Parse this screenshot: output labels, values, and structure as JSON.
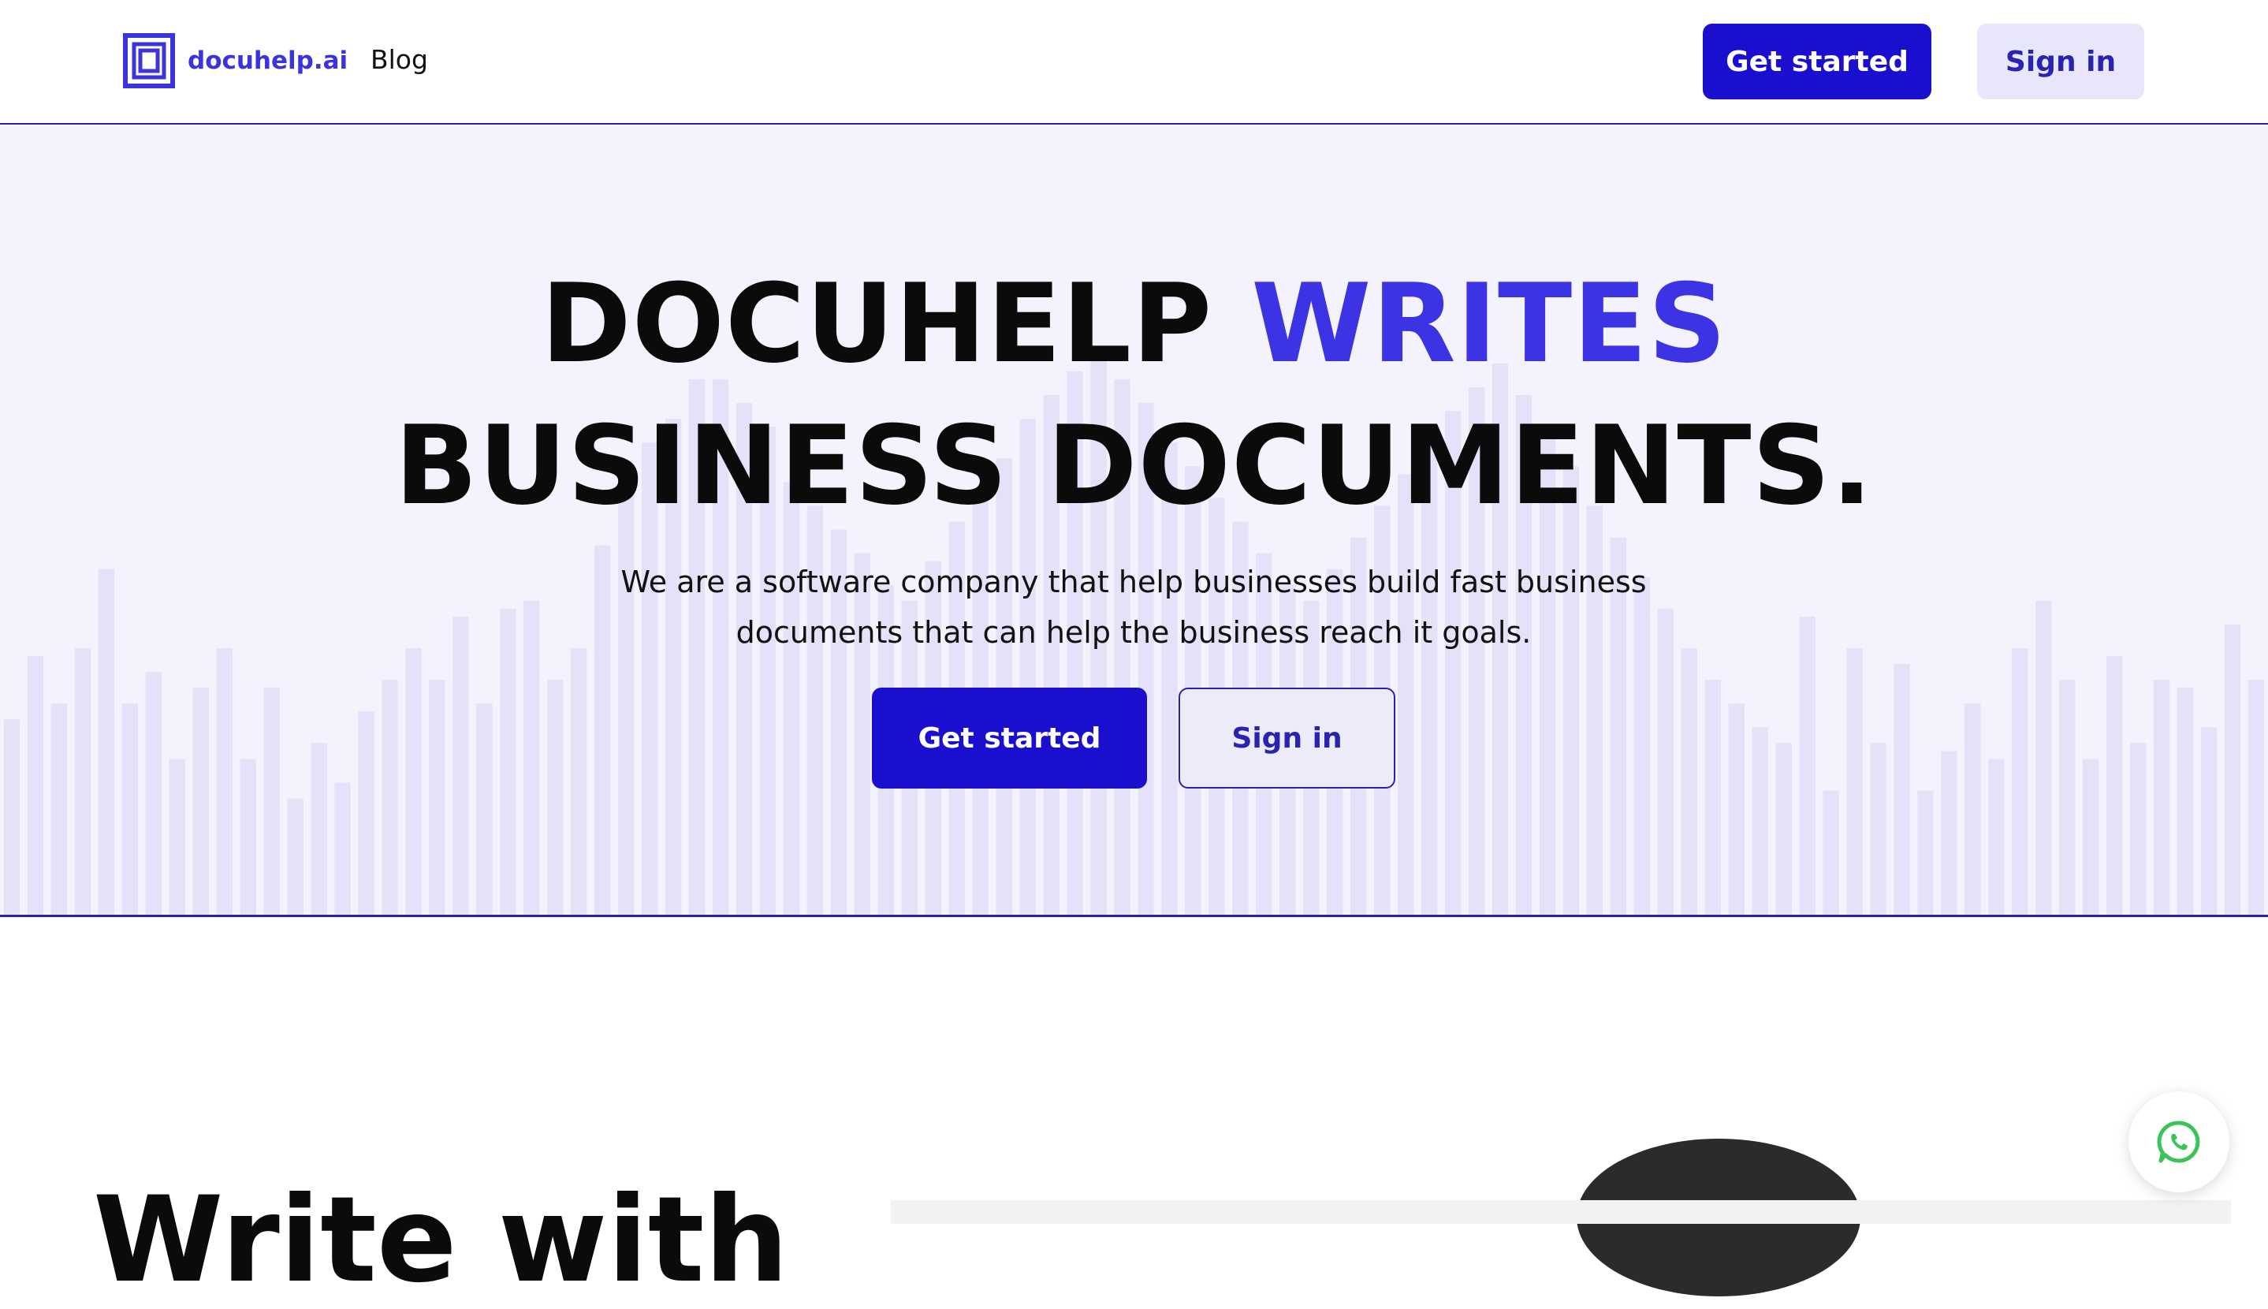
{
  "nav": {
    "logo_text": "docuhelp.ai",
    "blog_label": "Blog",
    "get_started_label": "Get started",
    "sign_in_label": "Sign in"
  },
  "hero": {
    "title_part1": "DOCUHELP ",
    "title_accent": "WRITES",
    "title_line2": "BUSINESS DOCUMENTS.",
    "subtitle_line1": "We are a software company that help businesses build fast business",
    "subtitle_line2": "documents that can help the business reach it goals.",
    "get_started_label": "Get started",
    "sign_in_label": "Sign in"
  },
  "section2": {
    "title_partial": "Write with"
  },
  "icons": {
    "logo": "docuhelp-logo-icon",
    "whatsapp": "whatsapp-icon"
  },
  "colors": {
    "brand": "#1b0fcf",
    "accent": "#3b33e4",
    "hero_bg": "#f4f3fd",
    "bar_fill": "#e4e2f9",
    "whatsapp_green": "#3cc35a"
  },
  "decor_bar_levels": [
    0.25,
    0.33,
    0.27,
    0.34,
    0.44,
    0.27,
    0.31,
    0.2,
    0.29,
    0.34,
    0.2,
    0.29,
    0.15,
    0.22,
    0.17,
    0.26,
    0.3,
    0.34,
    0.3,
    0.38,
    0.27,
    0.39,
    0.4,
    0.3,
    0.34,
    0.47,
    0.55,
    0.6,
    0.63,
    0.68,
    0.68,
    0.65,
    0.62,
    0.55,
    0.52,
    0.49,
    0.46,
    0.42,
    0.4,
    0.45,
    0.5,
    0.54,
    0.58,
    0.63,
    0.66,
    0.69,
    0.71,
    0.68,
    0.65,
    0.6,
    0.57,
    0.53,
    0.5,
    0.46,
    0.42,
    0.4,
    0.44,
    0.48,
    0.52,
    0.56,
    0.6,
    0.64,
    0.67,
    0.7,
    0.66,
    0.62,
    0.57,
    0.52,
    0.48,
    0.43,
    0.39,
    0.34,
    0.3,
    0.27,
    0.24,
    0.22,
    0.38,
    0.16,
    0.34,
    0.22,
    0.32,
    0.16,
    0.21,
    0.27,
    0.2,
    0.34,
    0.4,
    0.3,
    0.2,
    0.33,
    0.22,
    0.3,
    0.29,
    0.24,
    0.37,
    0.3
  ]
}
